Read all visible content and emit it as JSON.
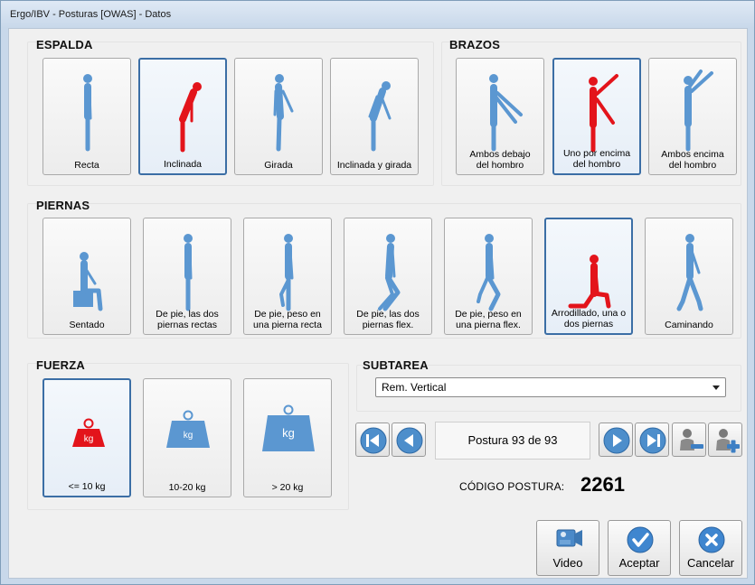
{
  "window": {
    "title": "Ergo/IBV - Posturas [OWAS] - Datos"
  },
  "colors": {
    "figure_normal": "#5b97d1",
    "figure_selected": "#e3141b",
    "selected_border": "#3b6ea5"
  },
  "espalda": {
    "title": "ESPALDA",
    "options": [
      {
        "label": "Recta",
        "icon": "standing-straight-icon",
        "selected": false
      },
      {
        "label": "Inclinada",
        "icon": "bent-forward-icon",
        "selected": true
      },
      {
        "label": "Girada",
        "icon": "twisted-icon",
        "selected": false
      },
      {
        "label": "Inclinada y girada",
        "icon": "bent-twisted-icon",
        "selected": false
      }
    ]
  },
  "brazos": {
    "title": "BRAZOS",
    "options": [
      {
        "label": "Ambos debajo\ndel hombro",
        "icon": "arms-below-icon",
        "selected": false
      },
      {
        "label": "Uno por encima\ndel hombro",
        "icon": "one-arm-above-icon",
        "selected": true
      },
      {
        "label": "Ambos encima\ndel hombro",
        "icon": "both-arms-above-icon",
        "selected": false
      }
    ]
  },
  "piernas": {
    "title": "PIERNAS",
    "options": [
      {
        "label": "Sentado",
        "icon": "sitting-icon",
        "selected": false
      },
      {
        "label": "De pie, las dos\npiernas rectas",
        "icon": "standing-legs-straight-icon",
        "selected": false
      },
      {
        "label": "De pie, peso en\nuna pierna recta",
        "icon": "standing-one-leg-icon",
        "selected": false
      },
      {
        "label": "De pie, las dos\npiernas flex.",
        "icon": "standing-legs-flexed-icon",
        "selected": false
      },
      {
        "label": "De pie, peso en\nuna pierna flex.",
        "icon": "standing-one-leg-flexed-icon",
        "selected": false
      },
      {
        "label": "Arrodillado, una o\ndos piernas",
        "icon": "kneeling-icon",
        "selected": true
      },
      {
        "label": "Caminando",
        "icon": "walking-icon",
        "selected": false
      }
    ]
  },
  "fuerza": {
    "title": "FUERZA",
    "options": [
      {
        "label": "<= 10 kg",
        "weight_text": "kg",
        "icon": "weight-small-icon",
        "selected": true
      },
      {
        "label": "10-20 kg",
        "weight_text": "kg",
        "icon": "weight-medium-icon",
        "selected": false
      },
      {
        "label": "> 20 kg",
        "weight_text": "kg",
        "icon": "weight-large-icon",
        "selected": false
      }
    ]
  },
  "subtarea": {
    "title": "SUBTAREA",
    "selected": "Rem. Vertical"
  },
  "navigation": {
    "counter": "Postura 93 de 93"
  },
  "codigo": {
    "label": "CÓDIGO POSTURA:",
    "value": "2261"
  },
  "actions": {
    "video": "Video",
    "accept": "Aceptar",
    "cancel": "Cancelar"
  }
}
